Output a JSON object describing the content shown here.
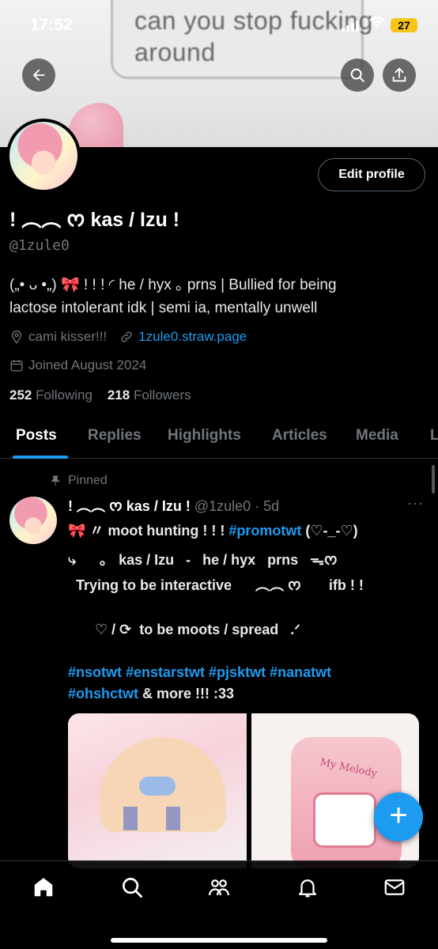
{
  "status_bar": {
    "time": "17:52",
    "battery": "27"
  },
  "banner": {
    "text": "can you stop fucking\naround"
  },
  "profile": {
    "edit_label": "Edit profile",
    "display_name": "! ︵︵ ᰔ kas / Izu !",
    "handle": "@1zule0",
    "bio_line1": "(„• ᴗ •„) 🎀 ! ! ! ◜ he / hyx ｡ prns | Bullied for being",
    "bio_line2": "lactose intolerant idk | semi ia, mentally unwell",
    "location": "cami kisser!!!",
    "website": "1zule0.straw.page",
    "joined": "Joined August 2024",
    "following_count": "252",
    "following_label": "Following",
    "followers_count": "218",
    "followers_label": "Followers"
  },
  "tabs": [
    "Posts",
    "Replies",
    "Highlights",
    "Articles",
    "Media",
    "L"
  ],
  "post": {
    "pinned_label": "Pinned",
    "author": "! ︵︵ ᰔ kas / Izu !",
    "handle_time": "@1zule0 · 5d",
    "more": "···",
    "line1_text": "🎀 〃 moot hunting ! ! ! ",
    "line1_tag": "#promotwt",
    "line1_tail": " (♡-_-♡)",
    "line2": "⤷      ｡   kas / Izu   -   he / hyx   prns   ᯓᰔ",
    "line3": "  Trying to be interactive      ︵︵ ᰔ       ifb ! !",
    "line4": "♡ / ⟳  to be moots / spread   .ᐟ",
    "tags1": "#nsotwt #enstarstwt #pjsktwt #nanatwt",
    "tags2": "#ohshctwt",
    "tags2_tail": " & more !!! :33"
  },
  "media": {
    "img2_caption": "My Melody"
  },
  "fab": {
    "label": "+"
  },
  "colors": {
    "accent": "#1d9bf0",
    "muted": "#71767b",
    "background": "#000000"
  }
}
